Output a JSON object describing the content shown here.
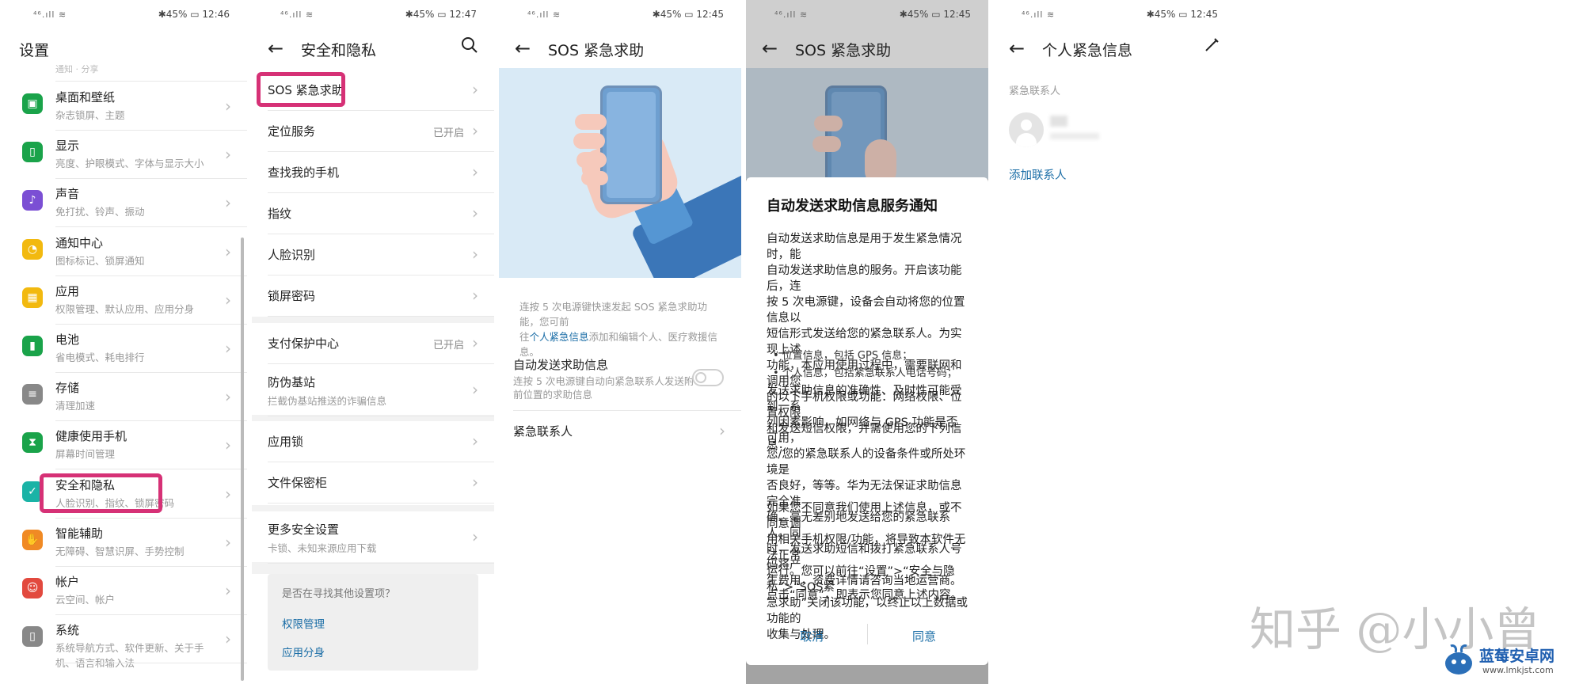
{
  "status": {
    "signal": "⁴⁶.ıll ≋",
    "battery": "✱45% ▭",
    "times": [
      "12:46",
      "12:47",
      "12:45",
      "12:45",
      "12:45"
    ]
  },
  "panel1": {
    "title": "设置",
    "clipped_top_text": "通知 · 分享",
    "items": [
      {
        "label": "桌面和壁纸",
        "sub": "杂志锁屏、主题",
        "icon": "wallpaper-icon",
        "color": "#1aa34a"
      },
      {
        "label": "显示",
        "sub": "亮度、护眼模式、字体与显示大小",
        "icon": "display-icon",
        "color": "#1aa34a"
      },
      {
        "label": "声音",
        "sub": "免打扰、铃声、振动",
        "icon": "sound-icon",
        "color": "#7b4fd4"
      },
      {
        "label": "通知中心",
        "sub": "图标标记、锁屏通知",
        "icon": "bell-icon",
        "color": "#f2b90f"
      },
      {
        "label": "应用",
        "sub": "权限管理、默认应用、应用分身",
        "icon": "apps-icon",
        "color": "#f2b90f"
      },
      {
        "label": "电池",
        "sub": "省电模式、耗电排行",
        "icon": "battery-icon",
        "color": "#1aa34a"
      },
      {
        "label": "存储",
        "sub": "清理加速",
        "icon": "storage-icon",
        "color": "#888888"
      },
      {
        "label": "健康使用手机",
        "sub": "屏幕时间管理",
        "icon": "hourglass-icon",
        "color": "#1aa34a"
      },
      {
        "label": "安全和隐私",
        "sub": "人脸识别、指纹、锁屏密码",
        "icon": "shield-icon",
        "color": "#1ab3a6"
      },
      {
        "label": "智能辅助",
        "sub": "无障碍、智慧识屏、手势控制",
        "icon": "hand-icon",
        "color": "#f08a24"
      },
      {
        "label": "帐户",
        "sub": "云空间、帐户",
        "icon": "account-icon",
        "color": "#e2493e"
      },
      {
        "label": "系统",
        "sub": "系统导航方式、软件更新、关于手机、语言和输入法",
        "icon": "system-icon",
        "color": "#888888"
      }
    ]
  },
  "panel2": {
    "title": "安全和隐私",
    "items": [
      {
        "label": "SOS 紧急求助",
        "status": ""
      },
      {
        "label": "定位服务",
        "status": "已开启"
      },
      {
        "label": "查找我的手机",
        "status": ""
      },
      {
        "label": "指纹",
        "status": ""
      },
      {
        "label": "人脸识别",
        "status": ""
      },
      {
        "label": "锁屏密码",
        "status": ""
      },
      {
        "label": "支付保护中心",
        "status": "已开启"
      },
      {
        "label": "防伪基站",
        "status": "",
        "sub": "拦截伪基站推送的诈骗信息"
      },
      {
        "label": "应用锁",
        "status": ""
      },
      {
        "label": "文件保密柜",
        "status": ""
      },
      {
        "label": "更多安全设置",
        "status": "",
        "sub": "卡锁、未知来源应用下载"
      }
    ],
    "help": {
      "question": "是否在寻找其他设置项？",
      "links": [
        "权限管理",
        "应用分身"
      ]
    }
  },
  "panel3": {
    "title": "SOS 紧急求助",
    "desc_line1": "连按 5 次电源键快速发起 SOS 紧急求助功能，您可前",
    "desc_line2_pre": "往",
    "desc_link": "个人紧急信息",
    "desc_line2_post": "添加和编辑个人、医疗救援信息。",
    "auto_label": "自动发送求助信息",
    "auto_sub1": "连按 5 次电源键自动向紧急联系人发送附带当",
    "auto_sub2": "前位置的求助信息",
    "auto_enabled": false,
    "contacts_label": "紧急联系人"
  },
  "panel4": {
    "title": "SOS 紧急求助",
    "dialog_title": "自动发送求助信息服务通知",
    "para1": [
      "自动发送求助信息是用于发生紧急情况时，能",
      "自动发送求助信息的服务。开启该功能后，连",
      "按 5 次电源键，设备会自动将您的位置信息以",
      "短信形式发送给您的紧急联系人。为实现上述",
      "功能，本应用使用过程中，需要联网和调用您",
      "的以下手机权限或功能：网络权限、位置权限",
      "和发送短信权限，并需使用您的下列信息："
    ],
    "bullets": [
      "• 位置信息，包括 GPS 信息；",
      "• 个人信息，包括紧急联系人电话号码；"
    ],
    "para2": [
      "发送求助信息的准确性、及时性可能受到一系",
      "列因素影响，如网络与 GPS 功能是否可用，",
      "您/您的紧急联系人的设备条件或所处环境是",
      "否良好，等等。华为无法保证求助信息完全准",
      "确、毫无差别地发送给您的紧急联系人。同",
      "时，发送求助短信和拨打紧急联系人号码将产",
      "生费用，资费详情请咨询当地运营商。"
    ],
    "para3": [
      "如果您不同意我们使用上述信息，或不同意调",
      "用相关手机权限/功能，将导致本软件无法正常",
      "运行。您可以前往“设置”>“安全与隐私”>“SOS紧",
      "急求助”关闭该功能，以终止以上数据或功能的",
      "收集与处理。"
    ],
    "para4": "点击“同意”，即表示您同意上述内容。",
    "cancel": "取消",
    "agree": "同意"
  },
  "panel5": {
    "title": "个人紧急信息",
    "section": "紧急联系人",
    "add_contact": "添加联系人"
  },
  "watermark": "知乎 @小小曾",
  "logo": {
    "name": "蓝莓安卓网",
    "url": "www.lmkjst.com"
  }
}
